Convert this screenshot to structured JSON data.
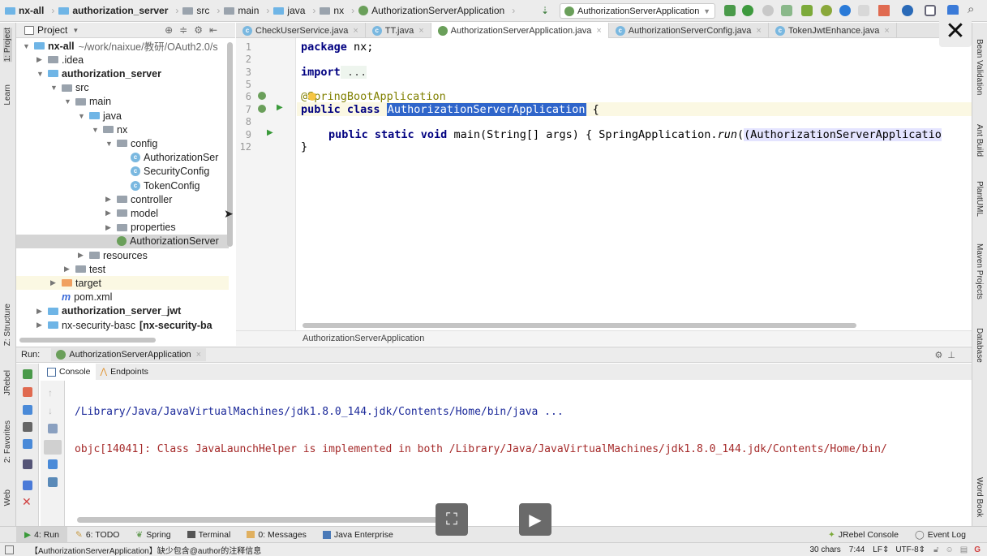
{
  "breadcrumb": [
    "nx-all",
    "authorization_server",
    "src",
    "main",
    "java",
    "nx",
    "AuthorizationServerApplication"
  ],
  "run_config": "AuthorizationServerApplication",
  "project_panel": {
    "title": "Project"
  },
  "tree": [
    {
      "label": "nx-all",
      "extra": "~/work/naixue/教研/OAuth2.0/s",
      "indent": 0,
      "arrow": "▼",
      "icon": "module",
      "bold": true
    },
    {
      "label": ".idea",
      "indent": 1,
      "arrow": "▶",
      "icon": "folder"
    },
    {
      "label": "authorization_server",
      "indent": 1,
      "arrow": "▼",
      "icon": "module",
      "bold": true
    },
    {
      "label": "src",
      "indent": 2,
      "arrow": "▼",
      "icon": "folder"
    },
    {
      "label": "main",
      "indent": 3,
      "arrow": "▼",
      "icon": "folder"
    },
    {
      "label": "java",
      "indent": 4,
      "arrow": "▼",
      "icon": "source-folder"
    },
    {
      "label": "nx",
      "indent": 5,
      "arrow": "▼",
      "icon": "package"
    },
    {
      "label": "config",
      "indent": 6,
      "arrow": "▼",
      "icon": "package"
    },
    {
      "label": "AuthorizationSer",
      "indent": 7,
      "arrow": "",
      "icon": "class"
    },
    {
      "label": "SecurityConfig",
      "indent": 7,
      "arrow": "",
      "icon": "class"
    },
    {
      "label": "TokenConfig",
      "indent": 7,
      "arrow": "",
      "icon": "class"
    },
    {
      "label": "controller",
      "indent": 6,
      "arrow": "▶",
      "icon": "package"
    },
    {
      "label": "model",
      "indent": 6,
      "arrow": "▶",
      "icon": "package"
    },
    {
      "label": "properties",
      "indent": 6,
      "arrow": "▶",
      "icon": "package"
    },
    {
      "label": "AuthorizationServer",
      "indent": 6,
      "arrow": "",
      "icon": "spring-class",
      "selected": true
    },
    {
      "label": "resources",
      "indent": 4,
      "arrow": "▶",
      "icon": "resources-folder"
    },
    {
      "label": "test",
      "indent": 3,
      "arrow": "▶",
      "icon": "folder"
    },
    {
      "label": "target",
      "indent": 2,
      "arrow": "▶",
      "icon": "excluded-folder",
      "highlight": true
    },
    {
      "label": "pom.xml",
      "indent": 2,
      "arrow": "",
      "icon": "maven"
    },
    {
      "label": "authorization_server_jwt",
      "indent": 1,
      "arrow": "▶",
      "icon": "module",
      "bold": true
    },
    {
      "label": "nx-security-basc",
      "extra": "[nx-security-ba",
      "indent": 1,
      "arrow": "▶",
      "icon": "module"
    }
  ],
  "editor_tabs": [
    {
      "label": "CheckUserService.java",
      "icon": "class"
    },
    {
      "label": "TT.java",
      "icon": "class"
    },
    {
      "label": "AuthorizationServerApplication.java",
      "icon": "spring-class",
      "active": true
    },
    {
      "label": "AuthorizationServerConfig.java",
      "icon": "class"
    },
    {
      "label": "TokenJwtEnhance.java",
      "icon": "class"
    }
  ],
  "code": {
    "line_numbers": [
      "1",
      "2",
      "3",
      "5",
      "6",
      "7",
      "8",
      "9",
      "12"
    ],
    "l1_kw": "package",
    "l1_rest": " nx;",
    "l3_kw": "import",
    "l3_rest": " ...",
    "l6": "@SpringBootApplication",
    "l7_kw": "public class",
    "l7_name": "AuthorizationServerApplication",
    "l7_rest": " {",
    "l9_kw": "public static void",
    "l9_a": " main(String[] args) { SpringApplication.",
    "l9_run": "run",
    "l9_b": "(AuthorizationServerApplicatio",
    "l12": "}"
  },
  "editor_breadcrumb": "AuthorizationServerApplication",
  "run_panel": {
    "label": "Run:",
    "tab": "AuthorizationServerApplication",
    "console_tab": "Console",
    "endpoints_tab": "Endpoints"
  },
  "console_lines": [
    "/Library/Java/JavaVirtualMachines/jdk1.8.0_144.jdk/Contents/Home/bin/java ...",
    "objc[14041]: Class JavaLaunchHelper is implemented in both /Library/Java/JavaVirtualMachines/jdk1.8.0_144.jdk/Contents/Home/bin/"
  ],
  "bottom_tools": [
    "4: Run",
    "6: TODO",
    "Spring",
    "Terminal",
    "0: Messages",
    "Java Enterprise"
  ],
  "bottom_right_tools": [
    "JRebel Console",
    "Event Log"
  ],
  "left_strip": [
    "1: Project",
    "Learn",
    "Z: Structure",
    "JRebel",
    "2: Favorites",
    "Web"
  ],
  "right_strip": [
    "Bean Validation",
    "Ant Build",
    "PlantUML",
    "Maven Projects",
    "Database",
    "Word Book"
  ],
  "status": {
    "message": "【AuthorizationServerApplication】缺少包含@author的注释信息",
    "chars": "30 chars",
    "position": "7:44",
    "line_sep": "LF",
    "encoding": "UTF-8"
  }
}
